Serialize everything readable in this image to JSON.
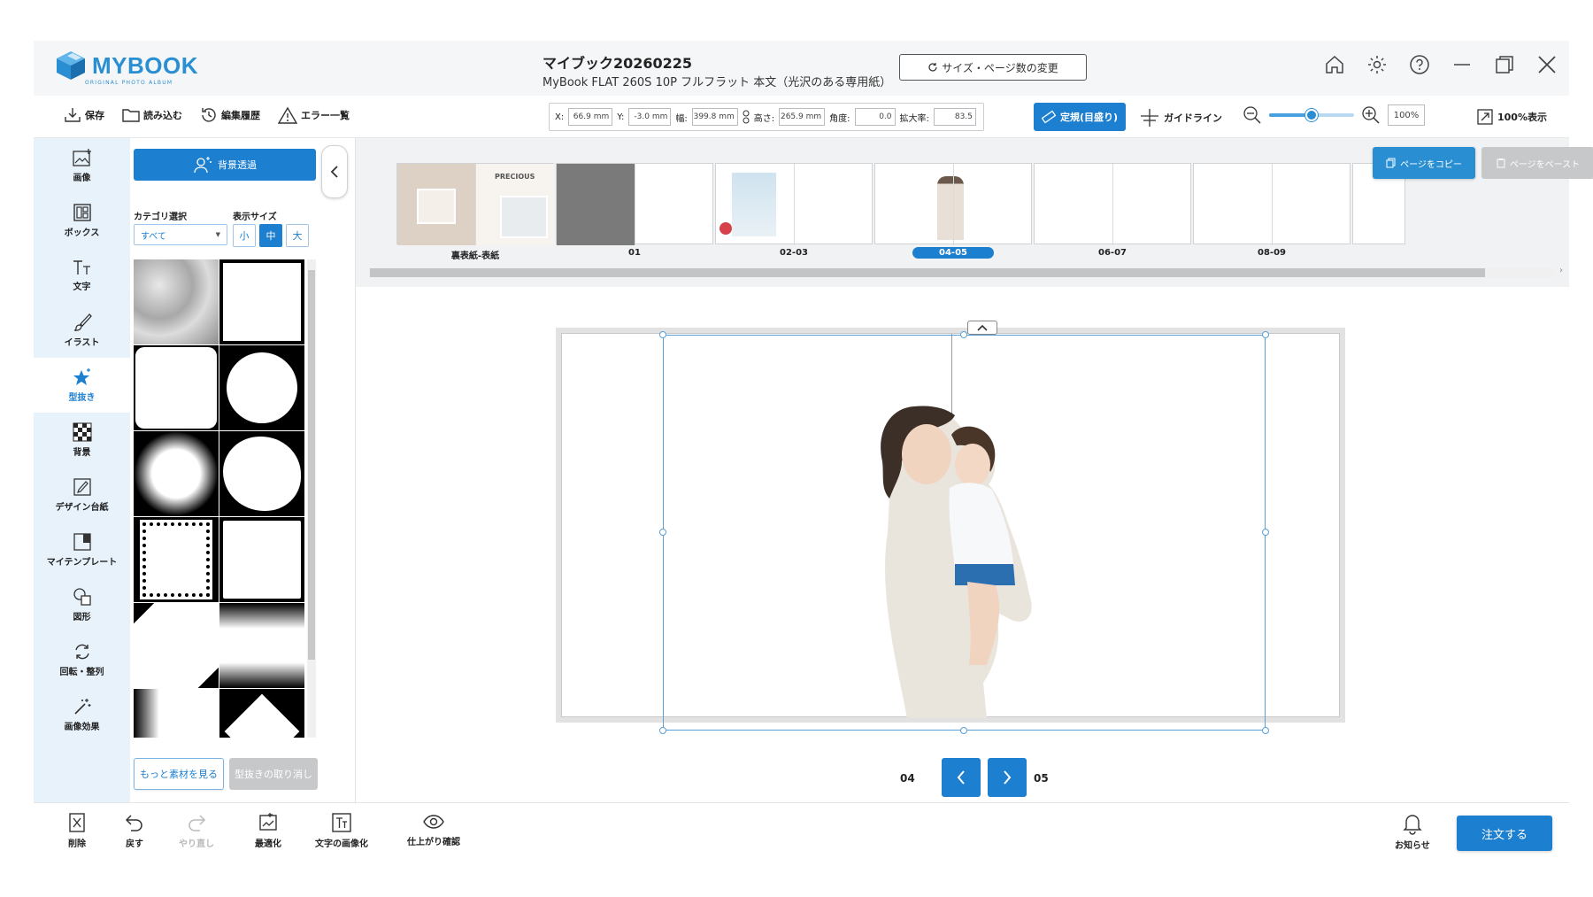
{
  "app": {
    "logo_text": "MYBOOK",
    "logo_sub": "ORIGINAL PHOTO ALBUM",
    "doc_title": "マイブック20260225",
    "doc_subtitle": "MyBook FLAT 260S 10P フルフラット 本文（光沢のある専用紙）",
    "resize_button": "サイズ・ページ数の変更"
  },
  "toolbar": {
    "save": "保存",
    "load": "読み込む",
    "history": "編集履歴",
    "errors": "エラー一覧",
    "coords": {
      "x_label": "X:",
      "x_value": "66.9 mm",
      "y_label": "Y:",
      "y_value": "-3.0 mm",
      "w_label": "幅:",
      "w_value": "399.8 mm",
      "h_label": "高さ:",
      "h_value": "265.9 mm",
      "angle_label": "角度:",
      "angle_value": "0.0",
      "scale_label": "拡大率:",
      "scale_value": "83.5"
    },
    "ruler_button": "定規(目盛り)",
    "guideline": "ガイドライン",
    "zoom_value": "100%",
    "zoom_level": 0.5,
    "fit_100": "100%表示"
  },
  "sidebar": {
    "items": [
      {
        "label": "画像",
        "icon": "image-add-icon"
      },
      {
        "label": "ボックス",
        "icon": "box-layout-icon"
      },
      {
        "label": "文字",
        "icon": "text-icon"
      },
      {
        "label": "イラスト",
        "icon": "brush-icon"
      },
      {
        "label": "型抜き",
        "icon": "star-mask-icon"
      },
      {
        "label": "背景",
        "icon": "checker-background-icon"
      },
      {
        "label": "デザイン台紙",
        "icon": "design-mount-icon"
      },
      {
        "label": "マイテンプレート",
        "icon": "template-icon"
      },
      {
        "label": "図形",
        "icon": "shapes-icon"
      },
      {
        "label": "回転・整列",
        "icon": "rotate-icon"
      },
      {
        "label": "画像効果",
        "icon": "magic-wand-icon"
      }
    ],
    "active_index": 4
  },
  "panel": {
    "bg_remove_button": "背景透過",
    "category_label": "カテゴリ選択",
    "category_value": "すべて",
    "size_label": "表示サイズ",
    "sizes": [
      "小",
      "中",
      "大"
    ],
    "selected_size": 1,
    "more_button": "もっと素材を見る",
    "undo_mask_button": "型抜きの取り消し"
  },
  "strip": {
    "pages": [
      {
        "label": "裏表紙-表紙"
      },
      {
        "label": "01"
      },
      {
        "label": "02-03"
      },
      {
        "label": "04-05",
        "selected": true
      },
      {
        "label": "06-07"
      },
      {
        "label": "08-09"
      }
    ],
    "cover_text": "PRECIOUS",
    "copy_page": "ページをコピー",
    "paste_page": "ページをペースト"
  },
  "canvas": {
    "left_page": "04",
    "right_page": "05"
  },
  "bottom": {
    "delete": "削除",
    "undo": "戻す",
    "redo": "やり直し",
    "optimize": "最適化",
    "text_to_image": "文字の画像化",
    "preview": "仕上がり確認",
    "notice": "お知らせ",
    "order": "注文する"
  },
  "colors": {
    "accent": "#1d7fd0",
    "sidebar_bg": "#e8f2fb",
    "titlebar_bg": "#f5f6f7"
  }
}
